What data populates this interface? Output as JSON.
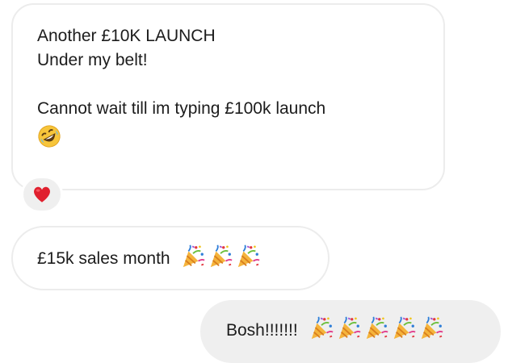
{
  "messages": [
    {
      "direction": "received",
      "lines": [
        "Another £10K LAUNCH",
        "Under my belt!",
        "",
        "Cannot wait till im typing £100k launch"
      ],
      "trailing_emoji": "rolling-on-floor-laughing-emoji",
      "reaction": "red-heart-emoji"
    },
    {
      "direction": "received",
      "text": "£15k sales month",
      "emojis": [
        "party-popper-emoji",
        "party-popper-emoji",
        "party-popper-emoji"
      ]
    },
    {
      "direction": "sent",
      "text": "Bosh!!!!!!!",
      "emojis": [
        "party-popper-emoji",
        "party-popper-emoji",
        "party-popper-emoji",
        "party-popper-emoji",
        "party-popper-emoji"
      ]
    }
  ],
  "colors": {
    "received_bubble": "#ffffff",
    "received_border": "#ececec",
    "sent_bubble": "#efefef",
    "text": "#1c1c1c",
    "heart": "#e0202e"
  }
}
